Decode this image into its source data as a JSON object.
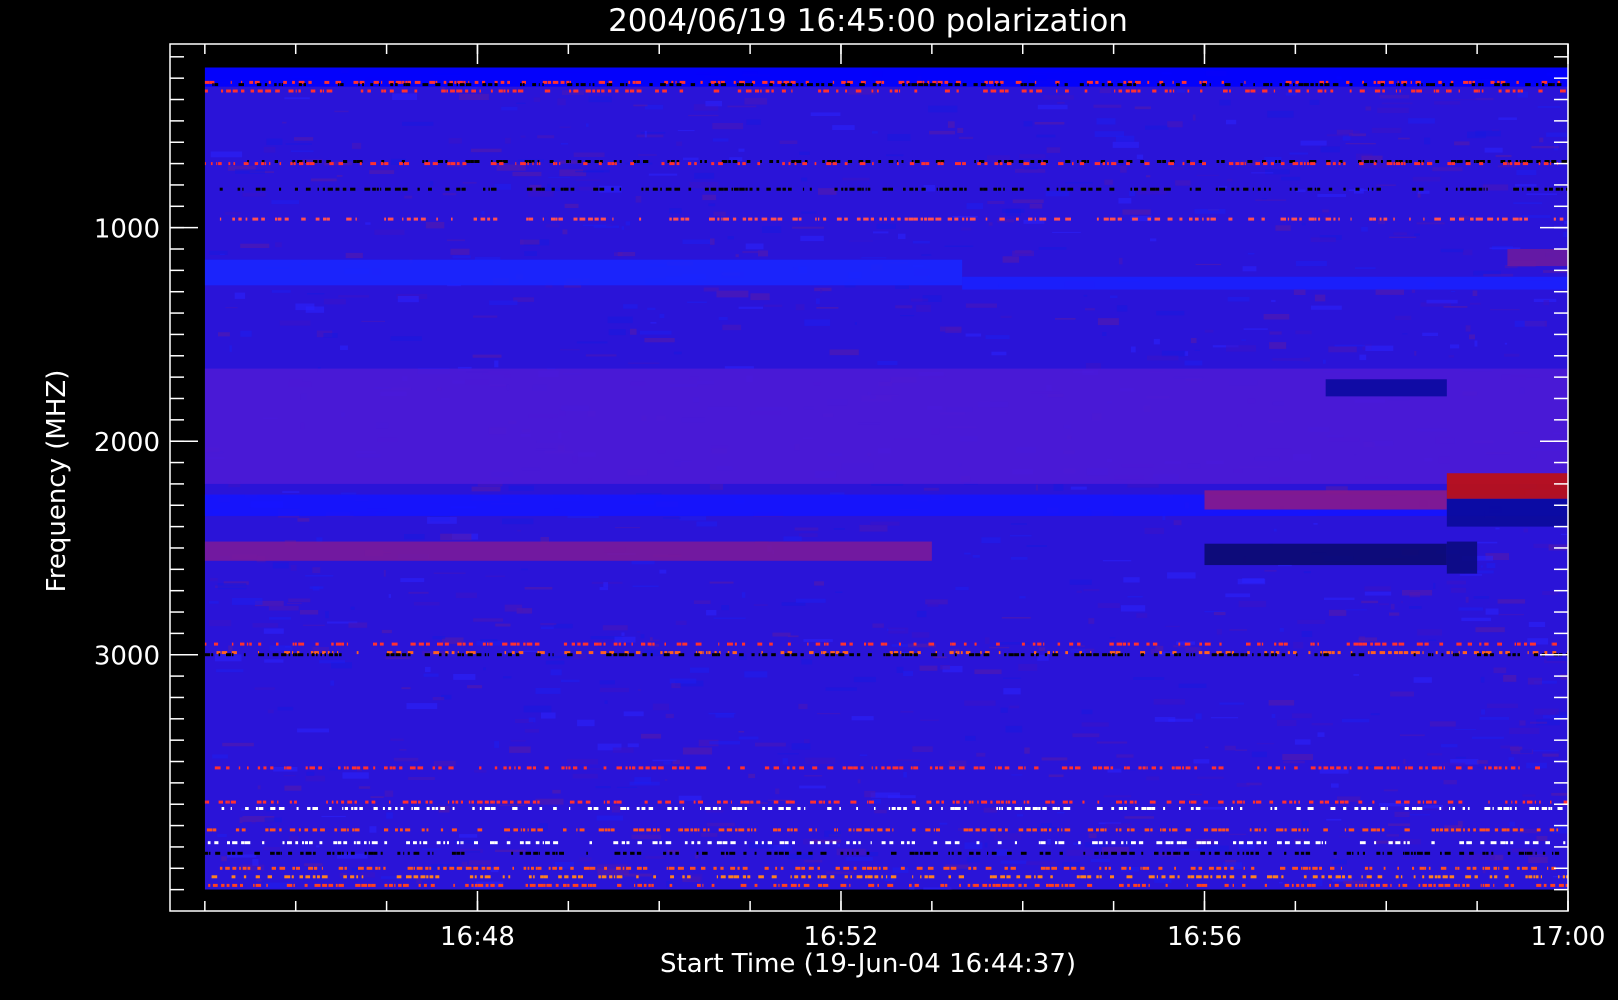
{
  "chart_data": {
    "type": "heatmap",
    "title": "2004/06/19 16:45:00 polarization",
    "xlabel": "Start Time (19-Jun-04 16:44:37)",
    "ylabel": "Frequency (MHZ)",
    "xlim": [
      "16:44:37",
      "17:00:00"
    ],
    "ylim": [
      4200,
      140
    ],
    "x_ticks": [
      "16:48",
      "16:52",
      "16:56",
      "17:00"
    ],
    "y_ticks": [
      1000,
      2000,
      3000
    ],
    "data_extent": {
      "time": [
        "16:45:00",
        "17:00:00"
      ],
      "frequency": [
        250,
        4100
      ]
    },
    "colormap": [
      "#000000",
      "#1010ff",
      "#ff2020",
      "#ffffff"
    ],
    "background_color": "#2a14d8",
    "bands": [
      {
        "time": [
          "16:45:00",
          "17:00:00"
        ],
        "frequency": [
          250,
          340
        ],
        "color": "#0000ff"
      },
      {
        "time": [
          "16:45:00",
          "17:00:00"
        ],
        "frequency": [
          1660,
          2200
        ],
        "color": "#4d1ad6"
      },
      {
        "time": [
          "16:45:00",
          "17:00:00"
        ],
        "frequency": [
          2250,
          2350
        ],
        "color": "#1414ff"
      },
      {
        "time": [
          "16:45:00",
          "16:53:20"
        ],
        "frequency": [
          1150,
          1270
        ],
        "color": "#1a26ff"
      },
      {
        "time": [
          "16:53:20",
          "17:00:00"
        ],
        "frequency": [
          1230,
          1290
        ],
        "color": "#1a20ff"
      },
      {
        "time": [
          "16:56:00",
          "16:58:40"
        ],
        "frequency": [
          2230,
          2320
        ],
        "color": "#8a1a8a"
      },
      {
        "time": [
          "16:58:40",
          "17:00:00"
        ],
        "frequency": [
          2150,
          2270
        ],
        "color": "#c01010"
      },
      {
        "time": [
          "16:58:40",
          "17:00:00"
        ],
        "frequency": [
          2270,
          2400
        ],
        "color": "#0a0a9a"
      },
      {
        "time": [
          "16:56:00",
          "16:58:40"
        ],
        "frequency": [
          2480,
          2580
        ],
        "color": "#0a0a70"
      },
      {
        "time": [
          "16:58:40",
          "16:59:00"
        ],
        "frequency": [
          2470,
          2620
        ],
        "color": "#0a0a80"
      },
      {
        "time": [
          "16:45:00",
          "16:53:00"
        ],
        "frequency": [
          2470,
          2560
        ],
        "color": "#7a1a9a"
      },
      {
        "time": [
          "16:57:20",
          "16:58:40"
        ],
        "frequency": [
          1710,
          1790
        ],
        "color": "#0a0aa0"
      },
      {
        "time": [
          "16:59:20",
          "17:00:00"
        ],
        "frequency": [
          1100,
          1180
        ],
        "color": "#6a1aa0"
      }
    ],
    "line_features_mhz": [
      {
        "frequency": 320,
        "color": "#ff3030"
      },
      {
        "frequency": 330,
        "color": "#000000"
      },
      {
        "frequency": 360,
        "color": "#ff3030"
      },
      {
        "frequency": 690,
        "color": "#000000"
      },
      {
        "frequency": 700,
        "color": "#ff3030"
      },
      {
        "frequency": 820,
        "color": "#000000"
      },
      {
        "frequency": 960,
        "color": "#ff5050"
      },
      {
        "frequency": 2950,
        "color": "#ff3030"
      },
      {
        "frequency": 2990,
        "color": "#ff6020"
      },
      {
        "frequency": 3000,
        "color": "#000000"
      },
      {
        "frequency": 3530,
        "color": "#ff3030"
      },
      {
        "frequency": 3690,
        "color": "#ff3030"
      },
      {
        "frequency": 3720,
        "color": "#ffffff"
      },
      {
        "frequency": 3820,
        "color": "#ff5020"
      },
      {
        "frequency": 3880,
        "color": "#ffffff"
      },
      {
        "frequency": 3930,
        "color": "#000000"
      },
      {
        "frequency": 4000,
        "color": "#ff5020"
      },
      {
        "frequency": 4040,
        "color": "#ff8020"
      },
      {
        "frequency": 4080,
        "color": "#ff4020"
      }
    ],
    "grid": false,
    "legend": "none"
  }
}
